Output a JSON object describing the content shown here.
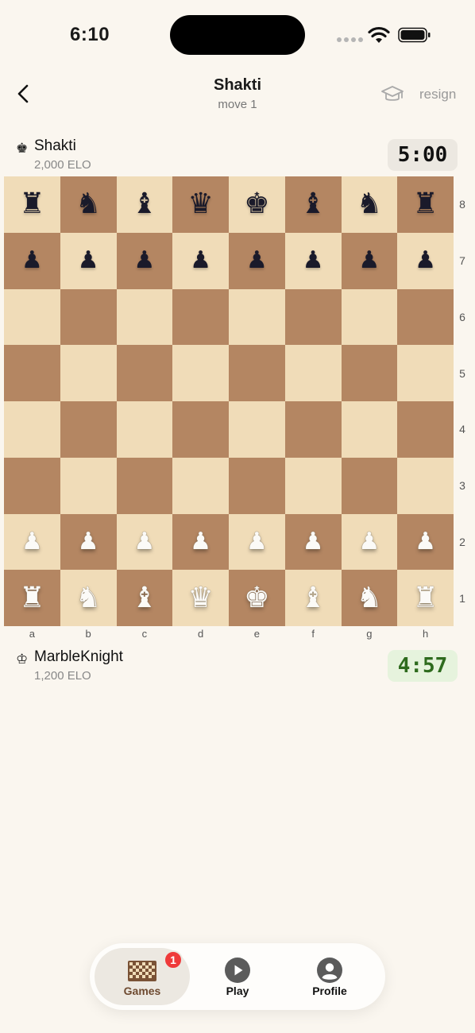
{
  "status_bar": {
    "time": "6:10"
  },
  "header": {
    "title": "Shakti",
    "subtitle": "move 1",
    "resign_label": "resign"
  },
  "players": {
    "top": {
      "name": "Shakti",
      "elo": "2,000 ELO",
      "clock": "5:00",
      "icon": "♚"
    },
    "bottom": {
      "name": "MarbleKnight",
      "elo": "1,200 ELO",
      "clock": "4:57",
      "icon": "♔"
    }
  },
  "board": {
    "files": [
      "a",
      "b",
      "c",
      "d",
      "e",
      "f",
      "g",
      "h"
    ],
    "ranks": [
      "8",
      "7",
      "6",
      "5",
      "4",
      "3",
      "2",
      "1"
    ],
    "rows": [
      [
        "r",
        "n",
        "b",
        "q",
        "k",
        "b",
        "n",
        "r"
      ],
      [
        "p",
        "p",
        "p",
        "p",
        "p",
        "p",
        "p",
        "p"
      ],
      [
        "",
        "",
        "",
        "",
        "",
        "",
        "",
        ""
      ],
      [
        "",
        "",
        "",
        "",
        "",
        "",
        "",
        ""
      ],
      [
        "",
        "",
        "",
        "",
        "",
        "",
        "",
        ""
      ],
      [
        "",
        "",
        "",
        "",
        "",
        "",
        "",
        ""
      ],
      [
        "P",
        "P",
        "P",
        "P",
        "P",
        "P",
        "P",
        "P"
      ],
      [
        "R",
        "N",
        "B",
        "Q",
        "K",
        "B",
        "N",
        "R"
      ]
    ],
    "light_color": "#f0dcb8",
    "dark_color": "#b48662"
  },
  "tabbar": {
    "tabs": [
      {
        "label": "Games",
        "icon": "chessboard-icon",
        "badge": "1",
        "active": true
      },
      {
        "label": "Play",
        "icon": "play-icon",
        "active": false
      },
      {
        "label": "Profile",
        "icon": "person-icon",
        "active": false
      }
    ]
  },
  "colors": {
    "accent": "#6e4a30",
    "clock_active_bg": "#e6f3dd",
    "clock_active_text": "#2e6b1e",
    "badge": "#ef3a3a"
  }
}
